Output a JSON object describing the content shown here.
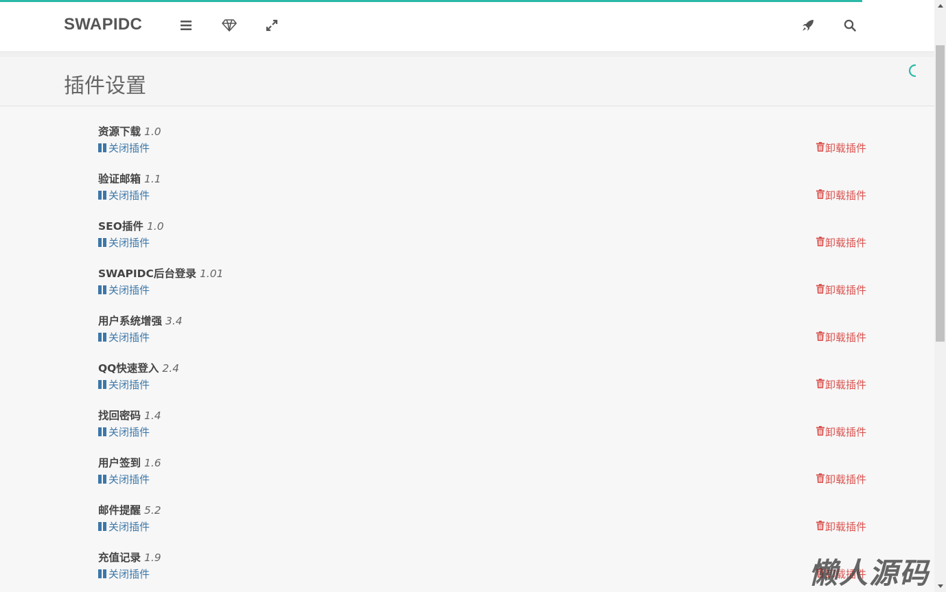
{
  "header": {
    "brand": "SWAPIDC",
    "icons": [
      "menu-icon",
      "diamond-icon",
      "expand-icon",
      "rocket-icon",
      "search-icon"
    ]
  },
  "page": {
    "title": "插件设置"
  },
  "plugins": [
    {
      "name": "资源下载",
      "version": "1.0",
      "toggle_label": "关闭插件",
      "uninstall_label": "卸载插件"
    },
    {
      "name": "验证邮箱",
      "version": "1.1",
      "toggle_label": "关闭插件",
      "uninstall_label": "卸载插件"
    },
    {
      "name": "SEO插件",
      "version": "1.0",
      "toggle_label": "关闭插件",
      "uninstall_label": "卸载插件"
    },
    {
      "name": "SWAPIDC后台登录",
      "version": "1.01",
      "toggle_label": "关闭插件",
      "uninstall_label": "卸载插件"
    },
    {
      "name": "用户系统增强",
      "version": "3.4",
      "toggle_label": "关闭插件",
      "uninstall_label": "卸载插件"
    },
    {
      "name": "QQ快速登入",
      "version": "2.4",
      "toggle_label": "关闭插件",
      "uninstall_label": "卸载插件"
    },
    {
      "name": "找回密码",
      "version": "1.4",
      "toggle_label": "关闭插件",
      "uninstall_label": "卸载插件"
    },
    {
      "name": "用户签到",
      "version": "1.6",
      "toggle_label": "关闭插件",
      "uninstall_label": "卸载插件"
    },
    {
      "name": "邮件提醒",
      "version": "5.2",
      "toggle_label": "关闭插件",
      "uninstall_label": "卸载插件"
    },
    {
      "name": "充值记录",
      "version": "1.9",
      "toggle_label": "关闭插件",
      "uninstall_label": "卸载插件"
    }
  ],
  "watermark": "懒人源码",
  "colors": {
    "accent": "#2bb9a7",
    "link": "#3d77a8",
    "danger": "#d9534f"
  }
}
